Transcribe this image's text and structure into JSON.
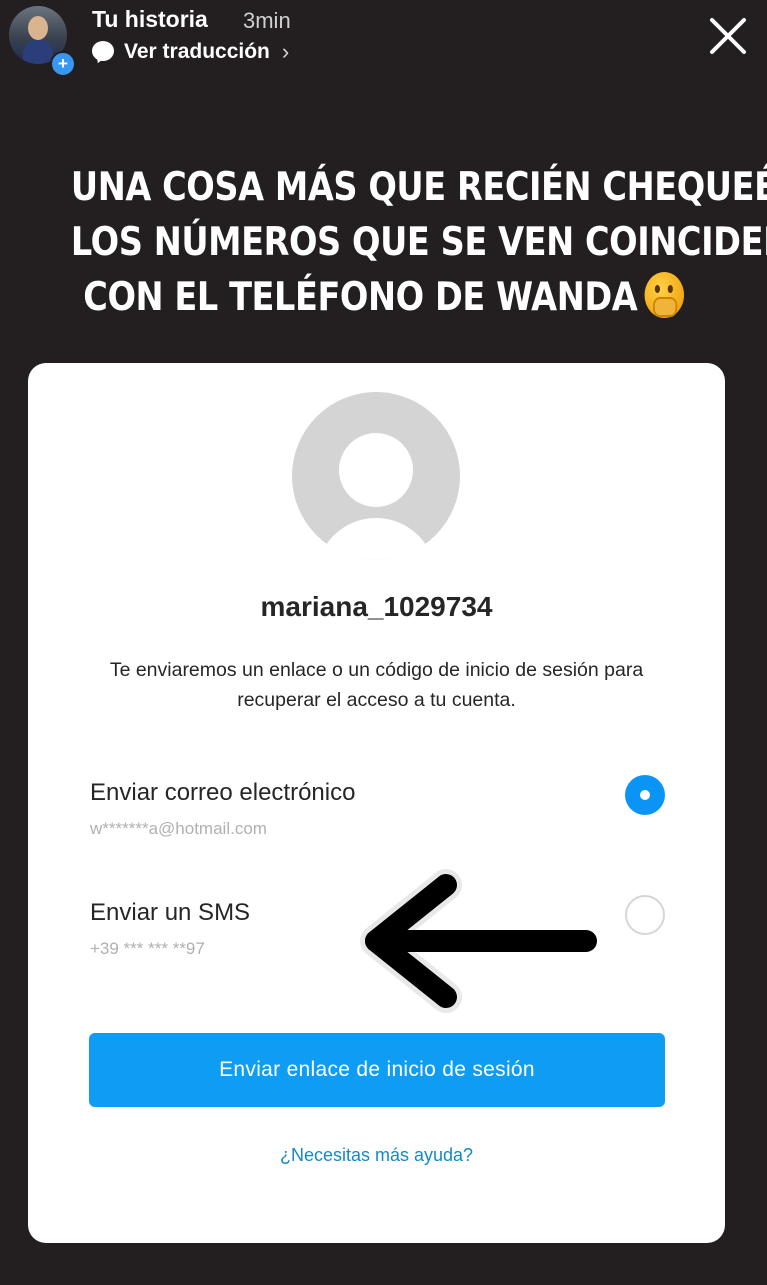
{
  "story": {
    "title": "Tu historia",
    "time": "3min",
    "translate_label": "Ver traducción",
    "icons": {
      "avatar": "profile-avatar",
      "add": "plus-badge-icon",
      "translate": "speech-bubble-icon",
      "chevron": "chevron-right-icon",
      "close": "close-icon"
    }
  },
  "headline": {
    "line1": "UNA COSA MÁS QUE RECIÉN CHEQUEÉ,",
    "line2": "LOS NÚMEROS QUE SE VEN COINCIDEN",
    "line3": "CON EL TELÉFONO DE WANDA",
    "emoji": "face-with-hand-over-mouth"
  },
  "card": {
    "username": "mariana_1029734",
    "description": "Te enviaremos un enlace o un código de inicio de sesión para recuperar el acceso a tu cuenta.",
    "options": [
      {
        "label": "Enviar correo electrónico",
        "detail": "w*******a@hotmail.com",
        "selected": true
      },
      {
        "label": "Enviar un SMS",
        "detail": "+39 *** *** **97",
        "selected": false
      }
    ],
    "send_button": "Enviar enlace de inicio de sesión",
    "help_link": "¿Necesitas más ayuda?"
  },
  "colors": {
    "background": "#231f20",
    "accent_blue": "#0f9cf3",
    "link_blue": "#1589c4",
    "card": "#ffffff"
  }
}
